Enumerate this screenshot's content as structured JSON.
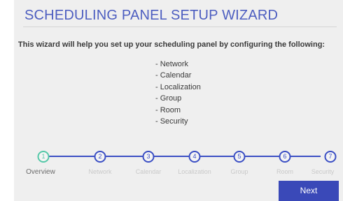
{
  "wizard": {
    "title": "SCHEDULING PANEL SETUP WIZARD",
    "intro": "This wizard will help you set up your scheduling panel by configuring the following:",
    "config_items": [
      "- Network",
      "- Calendar",
      "- Localization",
      "- Group",
      "- Room",
      "- Security"
    ]
  },
  "steps": [
    {
      "number": "1",
      "label": "Overview",
      "active": true
    },
    {
      "number": "2",
      "label": "Network",
      "active": false
    },
    {
      "number": "3",
      "label": "Calendar",
      "active": false
    },
    {
      "number": "4",
      "label": "Localization",
      "active": false
    },
    {
      "number": "5",
      "label": "Group",
      "active": false
    },
    {
      "number": "6",
      "label": "Room",
      "active": false
    },
    {
      "number": "7",
      "label": "Security",
      "active": false
    }
  ],
  "footer": {
    "next_label": "Next"
  },
  "colors": {
    "accent": "#3b4fc4",
    "active_step": "#55c8a8",
    "title": "#4d5ec0",
    "button": "#3a49b8",
    "panel_bg": "#efefef"
  }
}
